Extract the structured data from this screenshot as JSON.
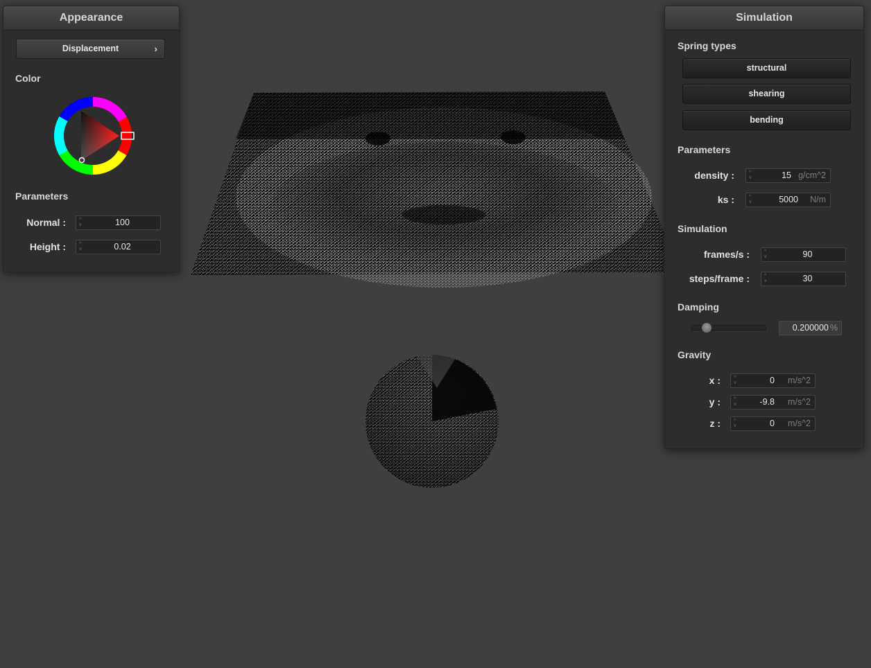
{
  "appearance": {
    "title": "Appearance",
    "shader_label": "Displacement",
    "shader_chevron": "›",
    "color_label": "Color",
    "color_value": "#ff0000",
    "params_label": "Parameters",
    "normal": {
      "label": "Normal :",
      "value": "100"
    },
    "height": {
      "label": "Height :",
      "value": "0.02"
    }
  },
  "simulation": {
    "title": "Simulation",
    "spring_types_label": "Spring types",
    "springs": [
      "structural",
      "shearing",
      "bending"
    ],
    "params_label": "Parameters",
    "density": {
      "label": "density :",
      "value": "15",
      "unit": "g/cm^2"
    },
    "ks": {
      "label": "ks :",
      "value": "5000",
      "unit": "N/m"
    },
    "sim_label": "Simulation",
    "fps": {
      "label": "frames/s :",
      "value": "90"
    },
    "steps": {
      "label": "steps/frame :",
      "value": "30"
    },
    "damping_label": "Damping",
    "damping": {
      "value": "0.200000",
      "unit": "%",
      "fraction": 0.2
    },
    "gravity_label": "Gravity",
    "gravity": [
      {
        "label": "x :",
        "value": "0",
        "unit": "m/s^2"
      },
      {
        "label": "y :",
        "value": "-9.8",
        "unit": "m/s^2"
      },
      {
        "label": "z :",
        "value": "0",
        "unit": "m/s^2"
      }
    ]
  },
  "colors": {
    "background": "#3f3f3f",
    "panel": "#2d2d2d",
    "accent_red": "#ff0000"
  }
}
